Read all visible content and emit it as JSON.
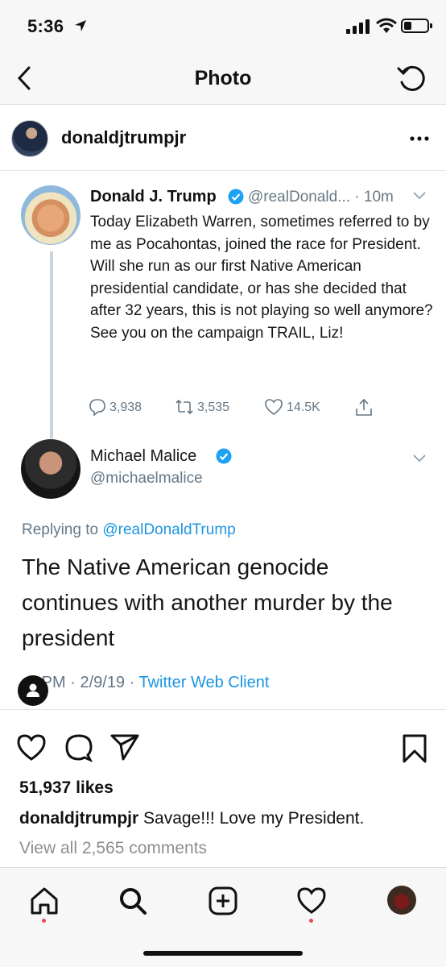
{
  "status_bar": {
    "time": "5:36"
  },
  "nav": {
    "title": "Photo"
  },
  "post": {
    "username": "donaldjtrumpjr"
  },
  "tweet": {
    "author": "Donald J. Trump",
    "handle": "@realDonald... · 10m",
    "text": "Today Elizabeth Warren, sometimes referred to by me as Pocahontas, joined the race for President. Will she run as our first Native American presidential candidate, or has she decided that after 32 years, this is not playing so well anymore? See you on the campaign TRAIL, Liz!",
    "replies": "3,938",
    "retweets": "3,535",
    "likes": "14.5K"
  },
  "reply": {
    "author": "Michael Malice",
    "handle": "@michaelmalice",
    "replying_prefix": "Replying to ",
    "replying_to": "@realDonaldTrump",
    "text": "The Native American genocide continues with another murder by the president",
    "time": "9 PM · 2/9/19 · ",
    "client": "Twitter Web Client"
  },
  "engagement": {
    "likes": "51,937 likes",
    "caption_user": "donaldjtrumpjr",
    "caption_text": " Savage!!! Love my President.",
    "view_comments": "View all 2,565 comments"
  },
  "colors": {
    "twitter_blue": "#1b95e0",
    "badge_blue": "#1da1f2",
    "notification_red": "#ed4956"
  },
  "icons": [
    "back-chevron-icon",
    "refresh-icon",
    "more-dots-icon",
    "heart-icon",
    "comment-icon",
    "send-icon",
    "bookmark-icon",
    "home-icon",
    "search-icon",
    "add-icon",
    "activity-icon"
  ]
}
